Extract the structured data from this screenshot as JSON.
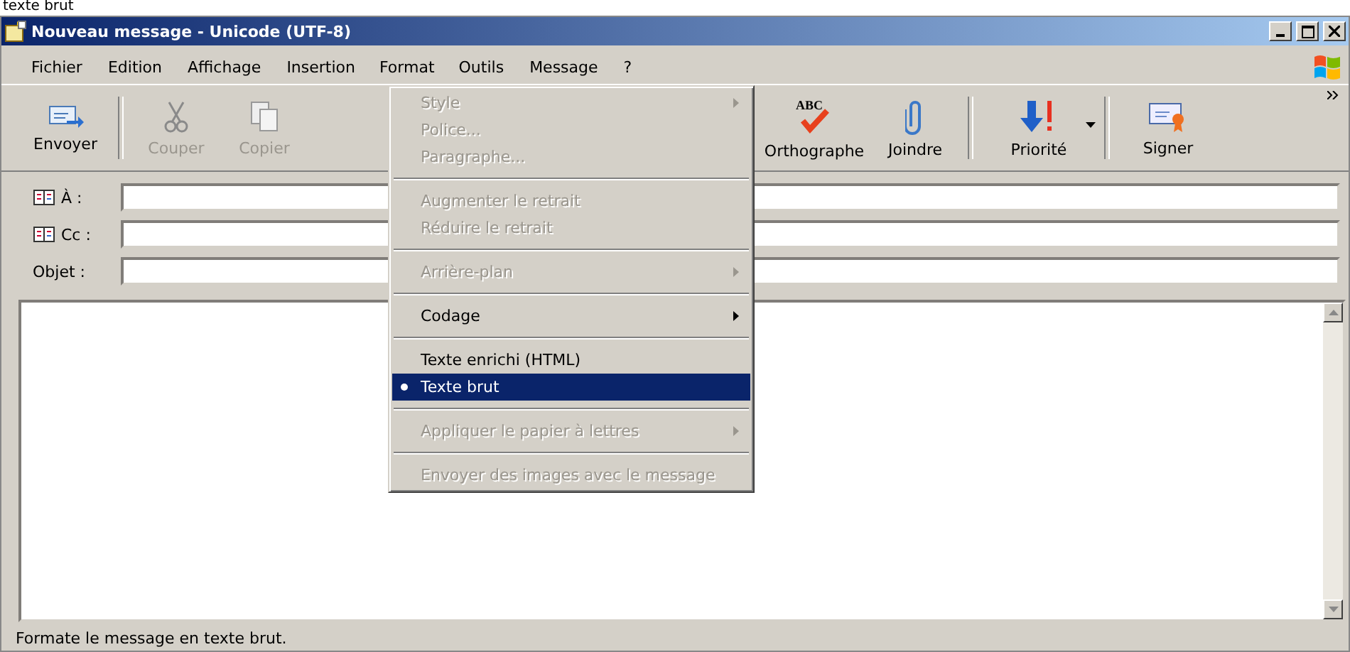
{
  "caption": "texte brut",
  "window": {
    "title": "Nouveau message - Unicode (UTF-8)"
  },
  "menubar": [
    {
      "label": "Fichier",
      "selected": false
    },
    {
      "label": "Edition",
      "selected": false
    },
    {
      "label": "Affichage",
      "selected": false
    },
    {
      "label": "Insertion",
      "selected": false
    },
    {
      "label": "Format",
      "selected": true
    },
    {
      "label": "Outils",
      "selected": false
    },
    {
      "label": "Message",
      "selected": false
    },
    {
      "label": "?",
      "selected": false
    }
  ],
  "toolbar": [
    {
      "kind": "send",
      "label": "Envoyer",
      "disabled": false
    },
    {
      "kind": "cut",
      "label": "Couper",
      "disabled": true
    },
    {
      "kind": "copy",
      "label": "Copier",
      "disabled": true
    },
    {
      "kind": "hidden"
    },
    {
      "kind": "spell",
      "label": "Orthographe",
      "icon_text": "ABC",
      "disabled": false
    },
    {
      "kind": "attach",
      "label": "Joindre",
      "disabled": false
    },
    {
      "kind": "priority",
      "label": "Priorité",
      "disabled": false
    },
    {
      "kind": "sign",
      "label": "Signer",
      "disabled": false
    }
  ],
  "fields": [
    {
      "kind": "book",
      "label": "À :"
    },
    {
      "kind": "book",
      "label": "Cc :"
    },
    {
      "kind": "plain",
      "label": "Objet :"
    }
  ],
  "format_menu": [
    {
      "kind": "item",
      "label": "Style",
      "disabled": true,
      "submenu": true,
      "checked": false,
      "selected": false
    },
    {
      "kind": "item",
      "label": "Police...",
      "disabled": true,
      "submenu": false,
      "checked": false,
      "selected": false
    },
    {
      "kind": "item",
      "label": "Paragraphe...",
      "disabled": true,
      "submenu": false,
      "checked": false,
      "selected": false
    },
    {
      "kind": "separator"
    },
    {
      "kind": "item",
      "label": "Augmenter le retrait",
      "disabled": true,
      "submenu": false,
      "checked": false,
      "selected": false
    },
    {
      "kind": "item",
      "label": "Réduire le retrait",
      "disabled": true,
      "submenu": false,
      "checked": false,
      "selected": false
    },
    {
      "kind": "separator"
    },
    {
      "kind": "item",
      "label": "Arrière-plan",
      "disabled": true,
      "submenu": true,
      "checked": false,
      "selected": false
    },
    {
      "kind": "separator"
    },
    {
      "kind": "item",
      "label": "Codage",
      "disabled": false,
      "submenu": true,
      "checked": false,
      "selected": false
    },
    {
      "kind": "separator"
    },
    {
      "kind": "item",
      "label": "Texte enrichi (HTML)",
      "disabled": false,
      "submenu": false,
      "checked": false,
      "selected": false
    },
    {
      "kind": "item",
      "label": "Texte brut",
      "disabled": false,
      "submenu": false,
      "checked": true,
      "selected": true
    },
    {
      "kind": "separator"
    },
    {
      "kind": "item",
      "label": "Appliquer le papier à lettres",
      "disabled": true,
      "submenu": true,
      "checked": false,
      "selected": false
    },
    {
      "kind": "separator"
    },
    {
      "kind": "item",
      "label": "Envoyer des images avec le message",
      "disabled": true,
      "submenu": false,
      "checked": false,
      "selected": false
    }
  ],
  "status_bar": "Formate le message en texte brut."
}
